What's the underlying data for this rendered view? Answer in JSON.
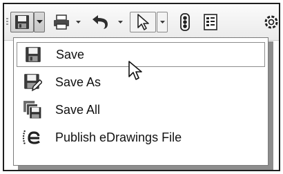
{
  "menu": {
    "items": [
      {
        "label": "Save",
        "icon": "save-icon",
        "hovered": true
      },
      {
        "label": "Save As",
        "icon": "save-as-icon",
        "hovered": false
      },
      {
        "label": "Save All",
        "icon": "save-all-icon",
        "hovered": false
      },
      {
        "label": "Publish eDrawings File",
        "icon": "edrawings-icon",
        "hovered": false
      }
    ]
  },
  "toolbar": {
    "buttons": [
      "save-icon",
      "print-icon",
      "undo-icon",
      "select-arrow-icon",
      "traffic-light-icon",
      "file-properties-icon",
      "options-gear-icon"
    ]
  }
}
